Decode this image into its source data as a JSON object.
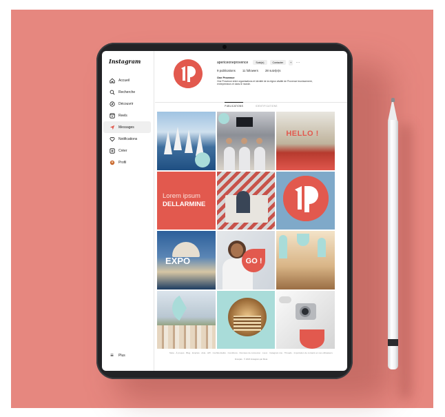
{
  "sidebar": {
    "logo": "Instagram",
    "items": [
      {
        "label": "Accueil",
        "icon": "home-icon"
      },
      {
        "label": "Recherche",
        "icon": "search-icon"
      },
      {
        "label": "Découvrir",
        "icon": "compass-icon"
      },
      {
        "label": "Reels",
        "icon": "reels-icon"
      },
      {
        "label": "Messages",
        "icon": "messages-icon"
      },
      {
        "label": "Notifications",
        "icon": "heart-icon"
      },
      {
        "label": "Créer",
        "icon": "plus-square-icon"
      },
      {
        "label": "Profil",
        "icon": "profile-icon"
      }
    ],
    "more_label": "Plus"
  },
  "profile": {
    "username": "apericeoneprovence",
    "follow_button": "Suivi(e)",
    "message_button": "Contacter",
    "stats": [
      "9 publications",
      "11 followers",
      "28 suivi(e)s"
    ],
    "bio_name": "One Provence",
    "bio_text": "One Provence entre organisations et identité de la région vitalité de Provence brunissement, entrepreneurs et dans le monde."
  },
  "tabs": [
    "PUBLICATIONS",
    "IDENTIFICATIONS"
  ],
  "posts": [
    {
      "text": ""
    },
    {
      "text": ""
    },
    {
      "text": "HELLO !"
    },
    {
      "line1": "Lorem ipsum",
      "line2": "DELLARMINE"
    },
    {
      "text": ""
    },
    {
      "text": ""
    },
    {
      "text": "EXPO"
    },
    {
      "text": "GO !"
    },
    {
      "text": ""
    },
    {
      "text": ""
    },
    {
      "text": ""
    },
    {
      "text": ""
    }
  ],
  "footer": {
    "links": "Meta · À propos · Blog · Emplois · Aide · API · Confidentialité · Conditions · Données de connexion · Lieux · Instagram Lite · Threads · Importation de contacts et non-utilisateurs",
    "copyright": "Français · © 2023 Instagram par Meta"
  },
  "colors": {
    "brand": "#e2594e",
    "background": "#e6877f",
    "accent_teal": "#a9dcd9"
  }
}
